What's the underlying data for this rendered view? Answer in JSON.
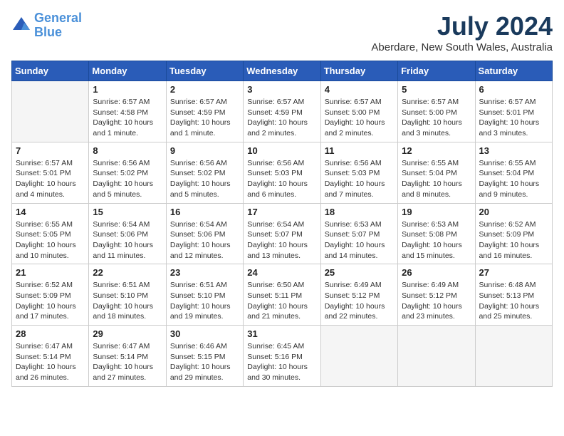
{
  "header": {
    "logo_line1": "General",
    "logo_line2": "Blue",
    "month": "July 2024",
    "location": "Aberdare, New South Wales, Australia"
  },
  "days_of_week": [
    "Sunday",
    "Monday",
    "Tuesday",
    "Wednesday",
    "Thursday",
    "Friday",
    "Saturday"
  ],
  "weeks": [
    [
      {
        "day": "",
        "info": ""
      },
      {
        "day": "1",
        "info": "Sunrise: 6:57 AM\nSunset: 4:58 PM\nDaylight: 10 hours\nand 1 minute."
      },
      {
        "day": "2",
        "info": "Sunrise: 6:57 AM\nSunset: 4:59 PM\nDaylight: 10 hours\nand 1 minute."
      },
      {
        "day": "3",
        "info": "Sunrise: 6:57 AM\nSunset: 4:59 PM\nDaylight: 10 hours\nand 2 minutes."
      },
      {
        "day": "4",
        "info": "Sunrise: 6:57 AM\nSunset: 5:00 PM\nDaylight: 10 hours\nand 2 minutes."
      },
      {
        "day": "5",
        "info": "Sunrise: 6:57 AM\nSunset: 5:00 PM\nDaylight: 10 hours\nand 3 minutes."
      },
      {
        "day": "6",
        "info": "Sunrise: 6:57 AM\nSunset: 5:01 PM\nDaylight: 10 hours\nand 3 minutes."
      }
    ],
    [
      {
        "day": "7",
        "info": "Sunrise: 6:57 AM\nSunset: 5:01 PM\nDaylight: 10 hours\nand 4 minutes."
      },
      {
        "day": "8",
        "info": "Sunrise: 6:56 AM\nSunset: 5:02 PM\nDaylight: 10 hours\nand 5 minutes."
      },
      {
        "day": "9",
        "info": "Sunrise: 6:56 AM\nSunset: 5:02 PM\nDaylight: 10 hours\nand 5 minutes."
      },
      {
        "day": "10",
        "info": "Sunrise: 6:56 AM\nSunset: 5:03 PM\nDaylight: 10 hours\nand 6 minutes."
      },
      {
        "day": "11",
        "info": "Sunrise: 6:56 AM\nSunset: 5:03 PM\nDaylight: 10 hours\nand 7 minutes."
      },
      {
        "day": "12",
        "info": "Sunrise: 6:55 AM\nSunset: 5:04 PM\nDaylight: 10 hours\nand 8 minutes."
      },
      {
        "day": "13",
        "info": "Sunrise: 6:55 AM\nSunset: 5:04 PM\nDaylight: 10 hours\nand 9 minutes."
      }
    ],
    [
      {
        "day": "14",
        "info": "Sunrise: 6:55 AM\nSunset: 5:05 PM\nDaylight: 10 hours\nand 10 minutes."
      },
      {
        "day": "15",
        "info": "Sunrise: 6:54 AM\nSunset: 5:06 PM\nDaylight: 10 hours\nand 11 minutes."
      },
      {
        "day": "16",
        "info": "Sunrise: 6:54 AM\nSunset: 5:06 PM\nDaylight: 10 hours\nand 12 minutes."
      },
      {
        "day": "17",
        "info": "Sunrise: 6:54 AM\nSunset: 5:07 PM\nDaylight: 10 hours\nand 13 minutes."
      },
      {
        "day": "18",
        "info": "Sunrise: 6:53 AM\nSunset: 5:07 PM\nDaylight: 10 hours\nand 14 minutes."
      },
      {
        "day": "19",
        "info": "Sunrise: 6:53 AM\nSunset: 5:08 PM\nDaylight: 10 hours\nand 15 minutes."
      },
      {
        "day": "20",
        "info": "Sunrise: 6:52 AM\nSunset: 5:09 PM\nDaylight: 10 hours\nand 16 minutes."
      }
    ],
    [
      {
        "day": "21",
        "info": "Sunrise: 6:52 AM\nSunset: 5:09 PM\nDaylight: 10 hours\nand 17 minutes."
      },
      {
        "day": "22",
        "info": "Sunrise: 6:51 AM\nSunset: 5:10 PM\nDaylight: 10 hours\nand 18 minutes."
      },
      {
        "day": "23",
        "info": "Sunrise: 6:51 AM\nSunset: 5:10 PM\nDaylight: 10 hours\nand 19 minutes."
      },
      {
        "day": "24",
        "info": "Sunrise: 6:50 AM\nSunset: 5:11 PM\nDaylight: 10 hours\nand 21 minutes."
      },
      {
        "day": "25",
        "info": "Sunrise: 6:49 AM\nSunset: 5:12 PM\nDaylight: 10 hours\nand 22 minutes."
      },
      {
        "day": "26",
        "info": "Sunrise: 6:49 AM\nSunset: 5:12 PM\nDaylight: 10 hours\nand 23 minutes."
      },
      {
        "day": "27",
        "info": "Sunrise: 6:48 AM\nSunset: 5:13 PM\nDaylight: 10 hours\nand 25 minutes."
      }
    ],
    [
      {
        "day": "28",
        "info": "Sunrise: 6:47 AM\nSunset: 5:14 PM\nDaylight: 10 hours\nand 26 minutes."
      },
      {
        "day": "29",
        "info": "Sunrise: 6:47 AM\nSunset: 5:14 PM\nDaylight: 10 hours\nand 27 minutes."
      },
      {
        "day": "30",
        "info": "Sunrise: 6:46 AM\nSunset: 5:15 PM\nDaylight: 10 hours\nand 29 minutes."
      },
      {
        "day": "31",
        "info": "Sunrise: 6:45 AM\nSunset: 5:16 PM\nDaylight: 10 hours\nand 30 minutes."
      },
      {
        "day": "",
        "info": ""
      },
      {
        "day": "",
        "info": ""
      },
      {
        "day": "",
        "info": ""
      }
    ]
  ]
}
